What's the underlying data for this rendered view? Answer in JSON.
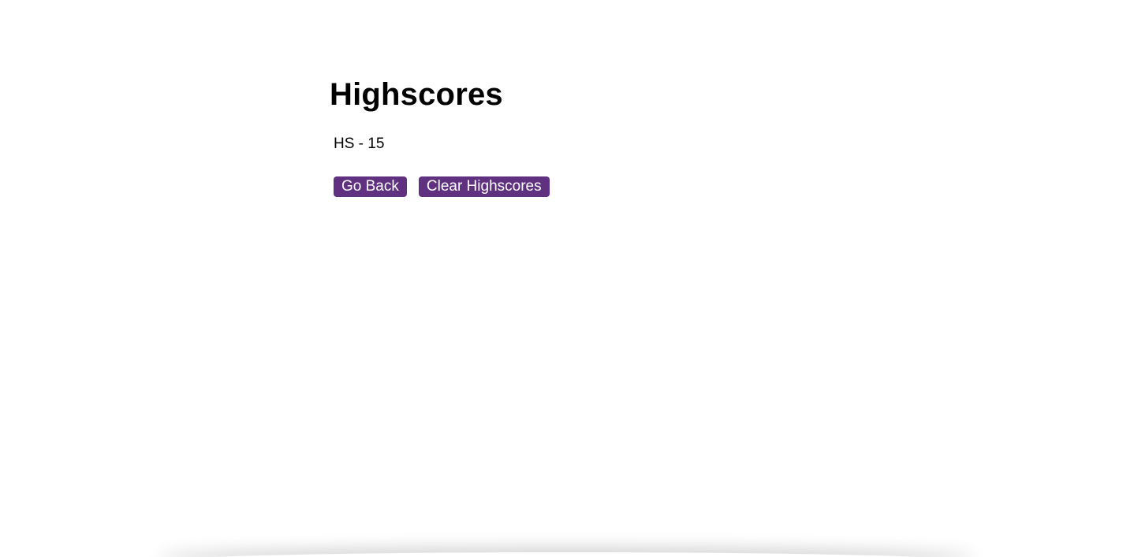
{
  "page": {
    "title": "Highscores"
  },
  "scores": [
    {
      "text": "HS - 15"
    }
  ],
  "actions": {
    "go_back_label": "Go Back",
    "clear_label": "Clear Highscores"
  },
  "colors": {
    "button_bg": "#5f3180",
    "button_text": "#ffffff",
    "text": "#000000",
    "background": "#ffffff"
  }
}
